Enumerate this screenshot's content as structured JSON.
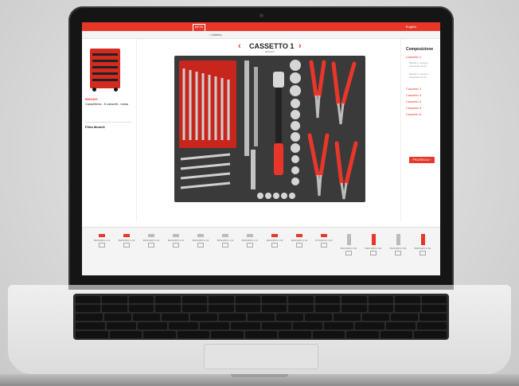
{
  "site": {
    "logo_text": "BETA",
    "lang_label": "English",
    "breadcrumb": "‹ Indietro"
  },
  "sidebar": {
    "product_code": "BW2400",
    "product_name": "Cassettiera - 6 cassetti - rossa",
    "filter_label": "Filtra Modelli"
  },
  "main": {
    "drawer_title": "CASSETTO 1",
    "drawer_subtitle": "BW2400",
    "prev_icon": "chevron-left-icon",
    "next_icon": "chevron-right-icon"
  },
  "right_panel": {
    "title": "Composizione",
    "items": [
      {
        "label": "Cassetto 1"
      },
      {
        "label": "Cassetto 2"
      },
      {
        "label": "Cassetto 3"
      },
      {
        "label": "Cassetto 4"
      },
      {
        "label": "Cassetto 5"
      },
      {
        "label": "Cassetto 6"
      }
    ],
    "notes": [
      "Modulo in spugna sfinestrato 24 pz",
      "Modulo in spugna sfinestrato 22 pz"
    ],
    "button_label": "PROSEGUI ›"
  },
  "thumbnails": [
    {
      "caption": "BW2400/C1 A1"
    },
    {
      "caption": "BW2400/C1 A2"
    },
    {
      "caption": "BW2400/C1 A3"
    },
    {
      "caption": "BW2400/C1 A4"
    },
    {
      "caption": "BW2400/C1 A5"
    },
    {
      "caption": "BW2400/C1 A6"
    },
    {
      "caption": "BW2400/C1 A7"
    },
    {
      "caption": "BW2400/C1 A8"
    },
    {
      "caption": "BW2400/C1 A9"
    },
    {
      "caption": "BT2400/C1 A10"
    },
    {
      "caption": "BW2400/C1 B1"
    },
    {
      "caption": "BW2400/C1 B2"
    },
    {
      "caption": "BW2400/C1 B3"
    },
    {
      "caption": "BW2400/C1 B4"
    }
  ],
  "colors": {
    "brand_red": "#e8372a",
    "foam": "#3a3a3a"
  }
}
